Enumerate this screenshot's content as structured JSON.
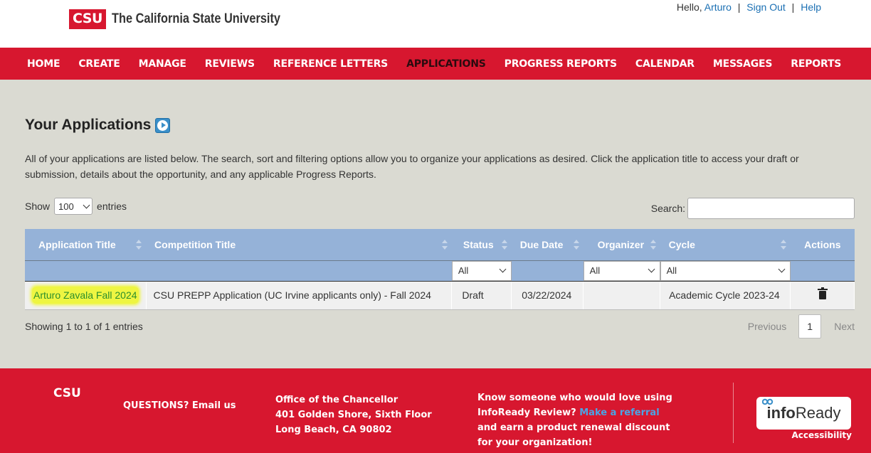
{
  "header": {
    "logo_mark": "CSU",
    "logo_text": "The California State University",
    "greeting": "Hello,",
    "user_name": "Arturo",
    "sign_out": "Sign Out",
    "help": "Help",
    "separator": "|"
  },
  "nav": {
    "items": [
      {
        "label": "HOME",
        "active": false
      },
      {
        "label": "CREATE",
        "active": false
      },
      {
        "label": "MANAGE",
        "active": false
      },
      {
        "label": "REVIEWS",
        "active": false
      },
      {
        "label": "REFERENCE LETTERS",
        "active": false
      },
      {
        "label": "APPLICATIONS",
        "active": true
      },
      {
        "label": "PROGRESS REPORTS",
        "active": false
      },
      {
        "label": "CALENDAR",
        "active": false
      },
      {
        "label": "MESSAGES",
        "active": false
      },
      {
        "label": "REPORTS",
        "active": false
      }
    ]
  },
  "main": {
    "title": "Your Applications",
    "intro": "All of your applications are listed below. The search, sort and filtering options allow you to organize your applications as desired. Click the application title to access your draft or submission, details about the opportunity, and any applicable Progress Reports.",
    "show_label": "Show",
    "show_value": "100",
    "entries_label": "entries",
    "search_label": "Search:",
    "search_value": ""
  },
  "table": {
    "columns": [
      "Application Title",
      "Competition Title",
      "Status",
      "Due Date",
      "Organizer",
      "Cycle",
      "Actions"
    ],
    "filters": {
      "status": "All",
      "organizer": "All",
      "cycle": "All"
    },
    "rows": [
      {
        "application_title": "Arturo Zavala Fall 2024",
        "competition_title": "CSU PREPP Application (UC Irvine applicants only) - Fall 2024",
        "status": "Draft",
        "due_date": "03/22/2024",
        "organizer": "",
        "cycle": "Academic Cycle 2023-24",
        "action_icon": "trash-icon"
      }
    ],
    "info": "Showing 1 to 1 of 1 entries",
    "pager": {
      "previous": "Previous",
      "page": "1",
      "next": "Next"
    }
  },
  "footer": {
    "logo": "CSU",
    "questions": "QUESTIONS? Email us",
    "office_line1": "Office of the Chancellor",
    "office_line2": "401 Golden Shore, Sixth Floor",
    "office_line3": "Long Beach, CA 90802",
    "know_line1": "Know someone who would love using",
    "know_line2_a": "InfoReady Review?",
    "know_line2_link": "Make a referral",
    "know_line3": "and earn a product renewal discount",
    "know_line4": "for your organization!",
    "badge_bold": "info",
    "badge_regular": "Ready",
    "accessibility": "Accessibility"
  },
  "colors": {
    "brand_red": "#d7172f",
    "table_header": "#95b2d8",
    "main_bg": "#dadad2",
    "link_blue": "#1a6fb3",
    "highlight": "#eef542"
  }
}
